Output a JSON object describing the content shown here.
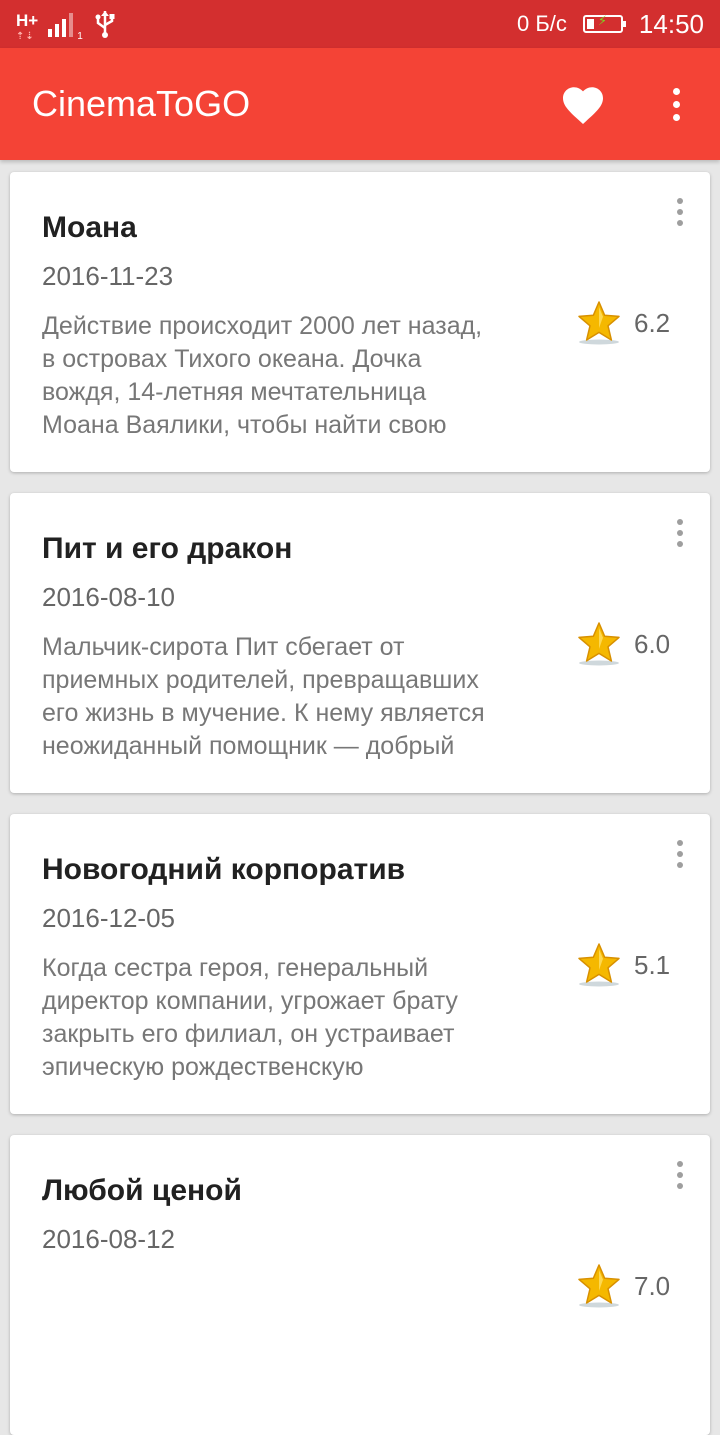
{
  "status_bar": {
    "network_type": "H+",
    "sim_index": "1",
    "speed": "0 Б/с",
    "time": "14:50"
  },
  "app_bar": {
    "title": "CinemaToGO",
    "icons": {
      "favorites": "heart-icon",
      "menu": "overflow-menu-icon"
    }
  },
  "colors": {
    "status_bar": "#d32f2f",
    "app_bar": "#f44336",
    "background": "#e7e7e7",
    "star": "#f5b800"
  },
  "movies": [
    {
      "title": "Моана",
      "date": "2016-11-23",
      "overview": "Действие происходит 2000 лет назад, в островах Тихого океана. Дочка вождя, 14-летняя мечтательница Моана Ваялики, чтобы найти свою",
      "rating": "6.2"
    },
    {
      "title": "Пит и его дракон",
      "date": "2016-08-10",
      "overview": "Мальчик-сирота Пит сбегает от приемных родителей, превращавших его жизнь в мучение. К нему является неожиданный помощник — добрый",
      "rating": "6.0"
    },
    {
      "title": "Новогодний корпоратив",
      "date": "2016-12-05",
      "overview": "Когда сестра героя, генеральный директор компании, угрожает брату закрыть его филиал, он устраивает эпическую рождественскую",
      "rating": "5.1"
    },
    {
      "title": "Любой ценой",
      "date": "2016-08-12",
      "overview": "",
      "rating": "7.0"
    }
  ]
}
